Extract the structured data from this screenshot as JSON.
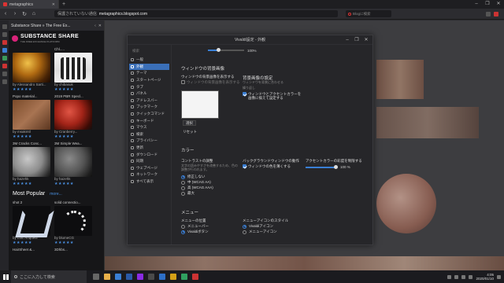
{
  "browser": {
    "tabs": [
      {
        "label": "metagraphics",
        "active": true
      },
      {
        "label": "",
        "active": false
      }
    ],
    "new_tab_symbol": "+",
    "window_controls": [
      "–",
      "❐",
      "✕"
    ],
    "address": {
      "warning": "保護されていない通信",
      "host": "metagraphics.blogspot.com"
    },
    "search_placeholder": "Blogに検索"
  },
  "web_panel": {
    "title": "Substance Share » The Free Ex...",
    "logo_text": "SUBSTANCE SHARE",
    "logo_sub": "THE FREE EXCHANGE PLATFORM",
    "cards": [
      {
        "caption": "",
        "by": "by Alessandro Sarti...",
        "stars": "★★★★★"
      },
      {
        "caption": "Chl.....",
        "by": "by chibasuk",
        "stars": "★★★★★"
      },
      {
        "caption": "Popo material...",
        "by": "by msakmtl",
        "stars": "★★★★★"
      },
      {
        "caption": "2019 PBR Specl...",
        "by": "by Cranberry...",
        "stars": "★★★★★"
      },
      {
        "caption": "3M Cracks Conc...",
        "by": "by hazehk",
        "stars": "★★★★★"
      },
      {
        "caption": "3M Simple Wea...",
        "by": "by hazehk",
        "stars": "★★★★★"
      }
    ],
    "popular_title": "Most Popular",
    "popular_more": "more...",
    "popular_cards": [
      {
        "caption": "shot 2",
        "by": "by Loic Anquetil",
        "stars": "★★★★★"
      },
      {
        "caption": "solid connectio...",
        "by": "by blumeCG",
        "stars": "★★★★★"
      }
    ],
    "popular_next": [
      "HairSheet &...",
      "3Dhbs..."
    ]
  },
  "dialog": {
    "title": "Vivaldi設定 - 外観",
    "search_placeholder": "検索",
    "sidebar": [
      {
        "label": "一般",
        "active": false
      },
      {
        "label": "外観",
        "active": true
      },
      {
        "label": "テーマ",
        "active": false
      },
      {
        "label": "スタートページ",
        "active": false
      },
      {
        "label": "タブ",
        "active": false
      },
      {
        "label": "パネル",
        "active": false
      },
      {
        "label": "アドレスバー",
        "active": false
      },
      {
        "label": "ブックマーク",
        "active": false
      },
      {
        "label": "クイックコマンド",
        "active": false
      },
      {
        "label": "キーボード",
        "active": false
      },
      {
        "label": "マウス",
        "active": false
      },
      {
        "label": "検索",
        "active": false
      },
      {
        "label": "プライバシー",
        "active": false
      },
      {
        "label": "更新",
        "active": false
      },
      {
        "label": "ダウンロード",
        "active": false
      },
      {
        "label": "同期",
        "active": false
      },
      {
        "label": "ウェブページ",
        "active": false
      },
      {
        "label": "ネットワーク",
        "active": false
      },
      {
        "label": "すべて表示",
        "active": false
      }
    ],
    "top_slider": {
      "label": "100%",
      "fraction": 0.3
    },
    "window_bg": {
      "section": "ウィンドウの背景画像",
      "show_label": "ウィンドウの背景画像を表示する",
      "show_checked": false,
      "show_sub": "ウィンドウの背景画像を表示する",
      "select_button": "選択",
      "reset_button": "リセット"
    },
    "bg_settings": {
      "section": "背景画像の設定",
      "opt1": "ウィンドウを背景に合わせる",
      "opt2": "繰り返し",
      "opt3": "ウィンドウとアクセントカラーを画像に揃えて設定する",
      "opt3_checked": true
    },
    "color": {
      "section": "カラー",
      "contrast_title": "コントラストの調整",
      "contrast_hint": "文字の読みやすさを改善するため、色の調整が行われます。",
      "contrast_options": [
        {
          "label": "修正しない",
          "selected": true
        },
        {
          "label": "中 (WCAG AA)",
          "selected": false
        },
        {
          "label": "高 (WCAG AAA)",
          "selected": false
        },
        {
          "label": "最大",
          "selected": false
        }
      ],
      "bg_window_title": "バックグラウンドウィンドウの動作",
      "bg_window_option": "ウィンドウの色を薄くする",
      "bg_window_checked": true,
      "accent_title": "アクセントカラーの彩度を制限する",
      "accent_value": "100 %",
      "accent_fraction": 0.95
    },
    "menu": {
      "section": "メニュー",
      "pos_title": "メニューの位置",
      "pos_options": [
        {
          "label": "メニューバー",
          "selected": false
        },
        {
          "label": "Vivaldiボタン",
          "selected": true
        }
      ],
      "icon_title": "メニューアイコンのスタイル",
      "icon_options": [
        {
          "label": "Vivaldiアイコン",
          "selected": true
        },
        {
          "label": "メニューアイコン",
          "selected": false
        }
      ]
    }
  },
  "taskbar": {
    "search_text": "ここに入力して検索",
    "time": "4:05",
    "date": "2020/01/10"
  },
  "colors": {
    "accent": "#3a7fd5",
    "vivaldi_red": "#d33333",
    "brand_pink": "#d9237a"
  }
}
